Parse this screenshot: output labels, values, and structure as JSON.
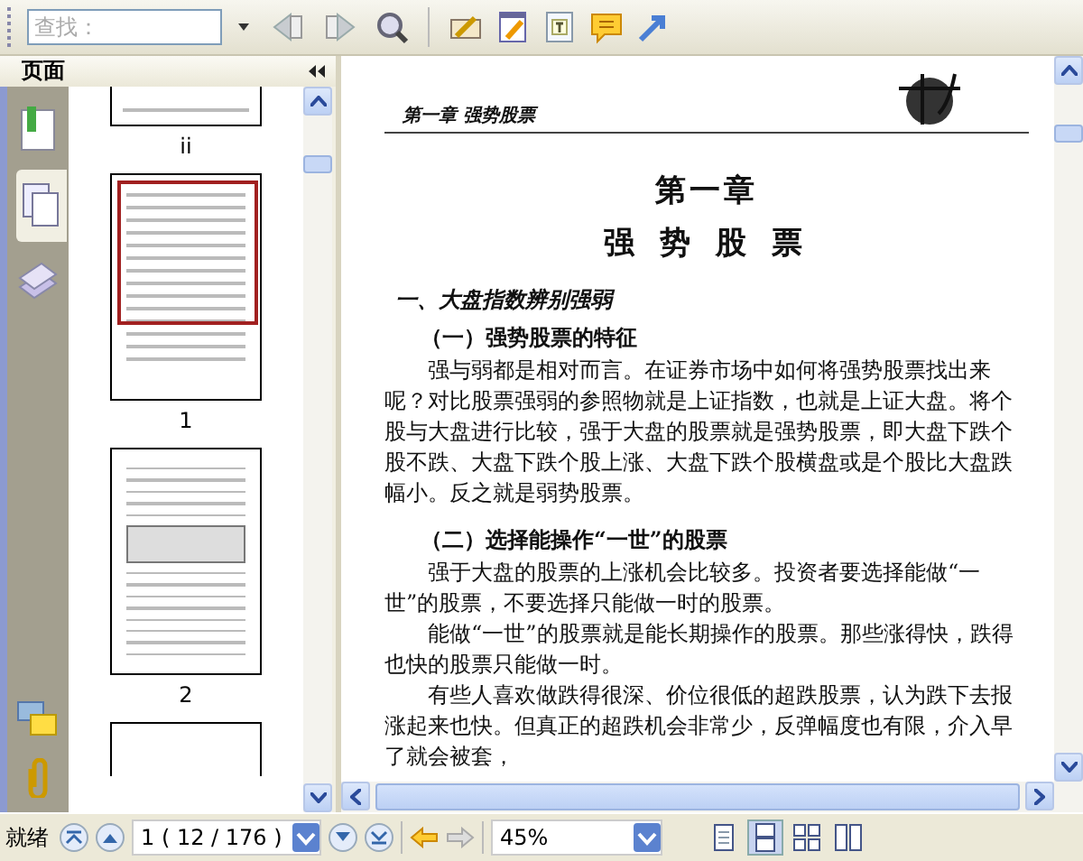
{
  "toolbar": {
    "search": {
      "placeholder": "查找："
    }
  },
  "sidebar": {
    "title": "页面",
    "nav_tabs": [
      {
        "kind": "bookmarks",
        "selected": false
      },
      {
        "kind": "pages",
        "selected": true
      },
      {
        "kind": "layers",
        "selected": false
      }
    ],
    "thumbnails": [
      {
        "label": "ii",
        "kind": "partial",
        "selected": false
      },
      {
        "label": "1",
        "kind": "chapter",
        "selected": true
      },
      {
        "label": "2",
        "kind": "chart",
        "selected": false
      }
    ]
  },
  "document": {
    "running_head": "第一章 强势股票",
    "chapter": "第一章",
    "title": "强 势 股 票",
    "section": "一、大盘指数辨别强弱",
    "subsections": [
      {
        "heading": "（一）强势股票的特征",
        "paragraphs": [
          "强与弱都是相对而言。在证券市场中如何将强势股票找出来呢？对比股票强弱的参照物就是上证指数，也就是上证大盘。将个股与大盘进行比较，强于大盘的股票就是强势股票，即大盘下跌个股不跌、大盘下跌个股上涨、大盘下跌个股横盘或是个股比大盘跌幅小。反之就是弱势股票。"
        ]
      },
      {
        "heading": "（二）选择能操作“一世”的股票",
        "paragraphs": [
          "强于大盘的股票的上涨机会比较多。投资者要选择能做“一世”的股票，不要选择只能做一时的股票。",
          "能做“一世”的股票就是能长期操作的股票。那些涨得快，跌得也快的股票只能做一时。",
          "有些人喜欢做跌得很深、价位很低的超跌股票，认为跌下去报涨起来也快。但真正的超跌机会非常少，反弹幅度也有限，介入早了就会被套，"
        ]
      }
    ]
  },
  "status": {
    "text": "就绪",
    "page": "1 ( 12 / 176 )",
    "zoom": "45%",
    "view_modes": [
      {
        "kind": "single",
        "selected": false
      },
      {
        "kind": "continuous",
        "selected": true
      },
      {
        "kind": "facing",
        "selected": false
      },
      {
        "kind": "facing-continuous",
        "selected": false
      }
    ]
  }
}
